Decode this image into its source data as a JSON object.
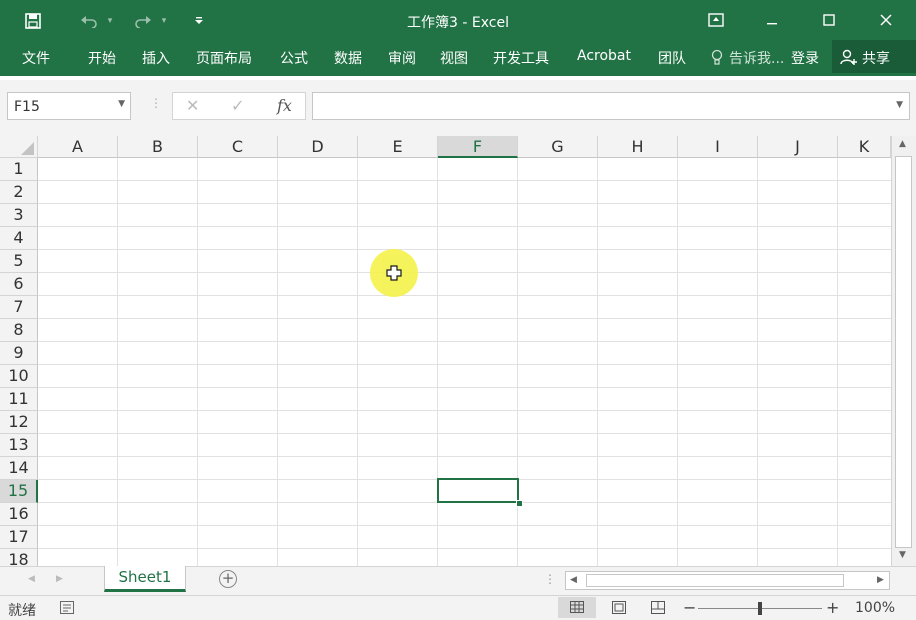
{
  "window": {
    "title": "工作簿3 - Excel"
  },
  "quick_access": {
    "save_icon": "save-icon",
    "undo_icon": "undo-icon",
    "redo_icon": "redo-icon",
    "customize_icon": "customize-qat-icon"
  },
  "ribbon": {
    "tabs": [
      "文件",
      "开始",
      "插入",
      "页面布局",
      "公式",
      "数据",
      "审阅",
      "视图",
      "开发工具",
      "Acrobat",
      "团队"
    ],
    "tell_me": "告诉我...",
    "login": "登录",
    "share": "共享"
  },
  "formula_bar": {
    "name_box": "F15",
    "cancel_symbol": "✕",
    "enter_symbol": "✓",
    "fx_label": "fx",
    "formula": ""
  },
  "grid": {
    "columns": [
      "A",
      "B",
      "C",
      "D",
      "E",
      "F",
      "G",
      "H",
      "I",
      "J",
      "K"
    ],
    "rows": [
      "1",
      "2",
      "3",
      "4",
      "5",
      "6",
      "7",
      "8",
      "9",
      "10",
      "11",
      "12",
      "13",
      "14",
      "15",
      "16",
      "17",
      "18"
    ],
    "selected_column": "F",
    "selected_row": "15"
  },
  "sheets": {
    "tabs": [
      "Sheet1"
    ],
    "active": "Sheet1",
    "add_symbol": "+"
  },
  "status": {
    "ready": "就绪",
    "zoom": "100%"
  },
  "colors": {
    "accent": "#217346",
    "halo": "#f5f24a"
  }
}
